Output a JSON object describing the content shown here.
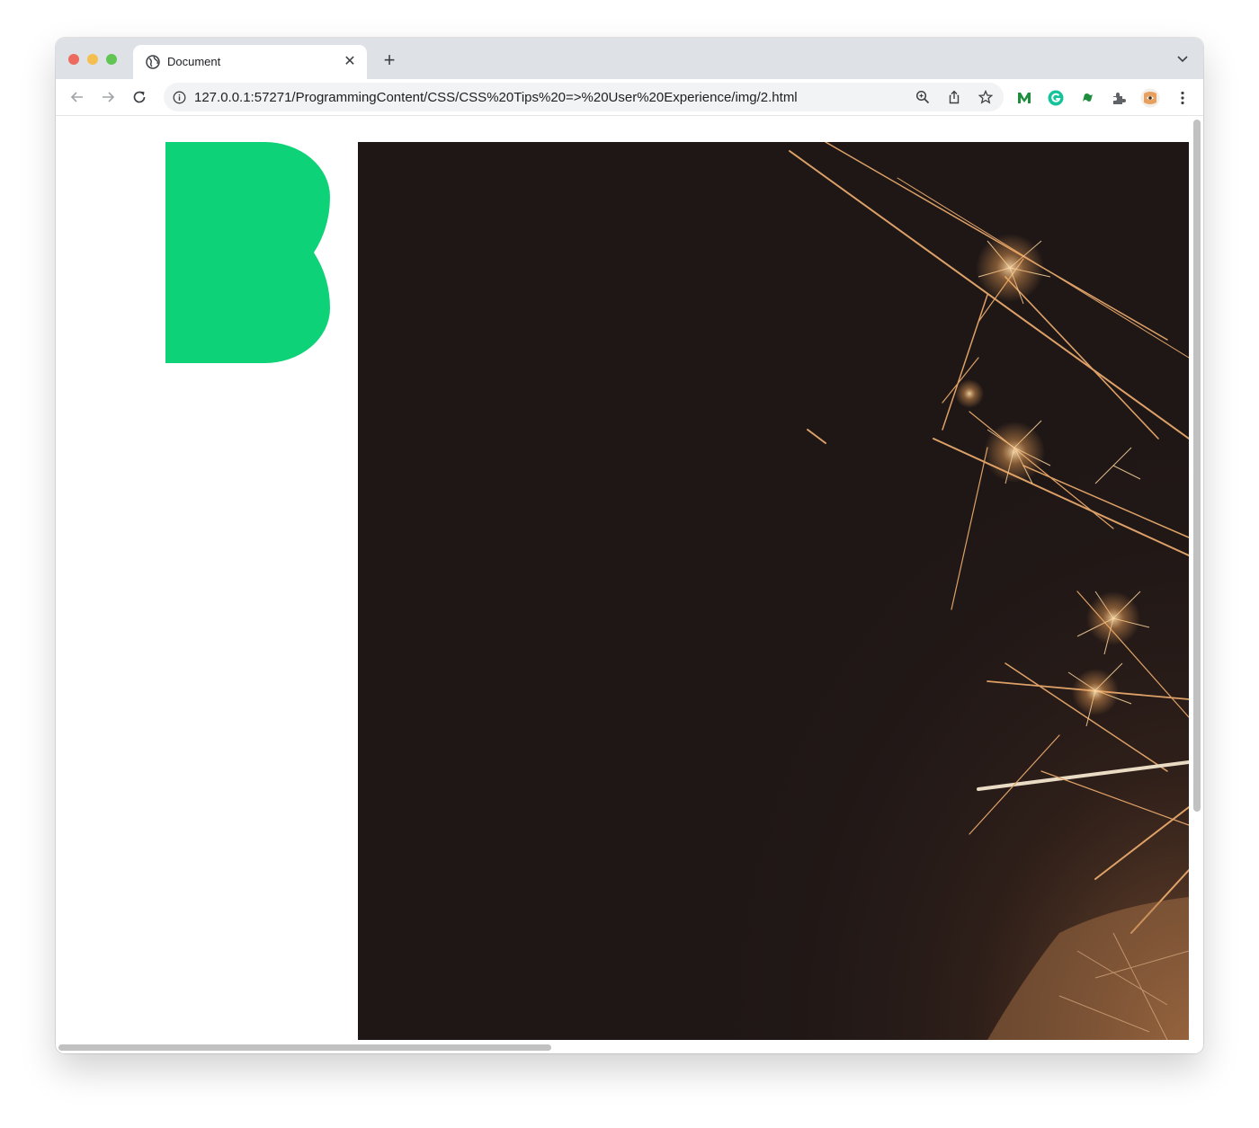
{
  "browser": {
    "tab": {
      "title": "Document",
      "close_glyph": "✕",
      "favicon": "globe-icon"
    },
    "new_tab_glyph": "+",
    "address_bar": {
      "url": "127.0.0.1:57271/ProgrammingContent/CSS/CSS%20Tips%20=>%20User%20Experience/img/2.html",
      "info_icon": "info-icon"
    },
    "toolbar_icons": [
      "back-icon",
      "forward-icon",
      "reload-icon",
      "zoom-icon",
      "share-icon",
      "bookmark-star-icon"
    ],
    "extensions": [
      {
        "name": "m-extension-icon",
        "color": "#1e8e3e"
      },
      {
        "name": "grammarly-icon",
        "color": "#15c39a"
      },
      {
        "name": "flag-extension-icon",
        "color": "#1e8e3e"
      },
      {
        "name": "puzzle-extensions-icon",
        "color": "#5f6368"
      },
      {
        "name": "profile-avatar-icon",
        "color": "#e8a060"
      }
    ]
  },
  "page": {
    "shape": {
      "name": "letter-b-shape",
      "color": "#0ed277"
    },
    "photo": {
      "name": "sparkler-photo",
      "background": "#1f1716",
      "accent": "#f2a55a"
    }
  }
}
